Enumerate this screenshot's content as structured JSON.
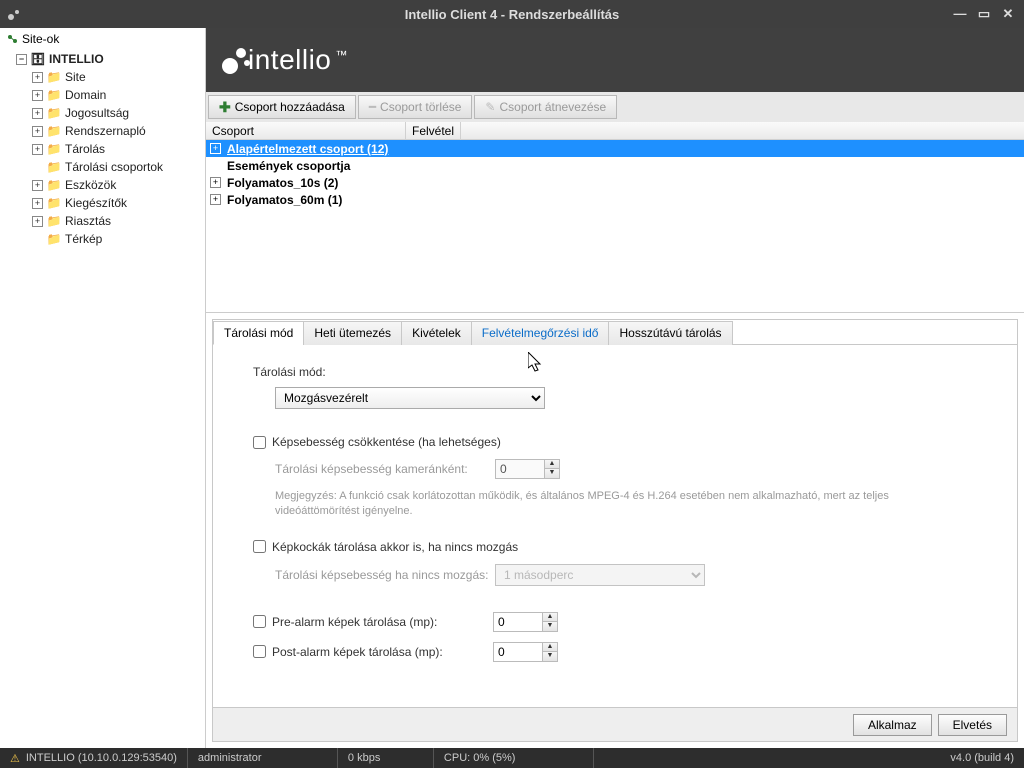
{
  "window": {
    "title": "Intellio Client 4 - Rendszerbeállítás"
  },
  "sidebar": {
    "header": "Site-ok",
    "root": "INTELLIO",
    "items": [
      {
        "label": "Site",
        "icon": "site"
      },
      {
        "label": "Domain",
        "icon": "domain"
      },
      {
        "label": "Jogosultság",
        "icon": "shield"
      },
      {
        "label": "Rendszernapló",
        "icon": "log"
      },
      {
        "label": "Tárolás",
        "icon": "folder"
      },
      {
        "label": "Tárolási csoportok",
        "icon": "folder",
        "selected": true,
        "noexpander": true
      },
      {
        "label": "Eszközök",
        "icon": "folder"
      },
      {
        "label": "Kiegészítők",
        "icon": "plugin"
      },
      {
        "label": "Riasztás",
        "icon": "alarm"
      },
      {
        "label": "Térkép",
        "icon": "folder",
        "noexpander": true
      }
    ]
  },
  "brand_tm": "™",
  "toolbar": {
    "add": "Csoport hozzáadása",
    "del": "Csoport törlése",
    "ren": "Csoport átnevezése"
  },
  "grid": {
    "col1": "Csoport",
    "col2": "Felvétel",
    "rows": [
      {
        "label": "Alapértelmezett csoport (12)",
        "sel": true,
        "exp": "+"
      },
      {
        "label": "Események csoportja",
        "exp": ""
      },
      {
        "label": "Folyamatos_10s (2)",
        "exp": "+"
      },
      {
        "label": "Folyamatos_60m (1)",
        "exp": "+"
      }
    ]
  },
  "tabs": {
    "items": [
      {
        "label": "Tárolási mód",
        "active": true
      },
      {
        "label": "Heti ütemezés"
      },
      {
        "label": "Kivételek"
      },
      {
        "label": "Felvételmegőrzési idő",
        "hover": true
      },
      {
        "label": "Hosszútávú tárolás"
      }
    ]
  },
  "panel": {
    "mode_label": "Tárolási mód:",
    "mode_value": "Mozgásvezérelt",
    "chk_reduce": "Képsebesség csökkentése (ha lehetséges)",
    "fps_label": "Tárolási képsebesség kameránként:",
    "fps_value": "0",
    "note": "Megjegyzés: A funkció csak korlátozottan működik, és általános MPEG-4 és H.264 esetében nem alkalmazható, mert az teljes videóáttömörítést igényelne.",
    "chk_store_no_motion": "Képkockák tárolása akkor is, ha nincs mozgás",
    "nomotion_fps_label": "Tárolási képsebesség ha nincs mozgás:",
    "nomotion_fps_value": "1 másodperc",
    "chk_prealarm": "Pre-alarm képek tárolása (mp):",
    "prealarm_value": "0",
    "chk_postalarm": "Post-alarm képek tárolása (mp):",
    "postalarm_value": "0"
  },
  "buttons": {
    "apply": "Alkalmaz",
    "cancel": "Elvetés"
  },
  "status": {
    "site": "INTELLIO (10.10.0.129:53540)",
    "user": "administrator",
    "bw": "0 kbps",
    "cpu": "CPU: 0% (5%)",
    "ver": "v4.0 (build 4)"
  }
}
